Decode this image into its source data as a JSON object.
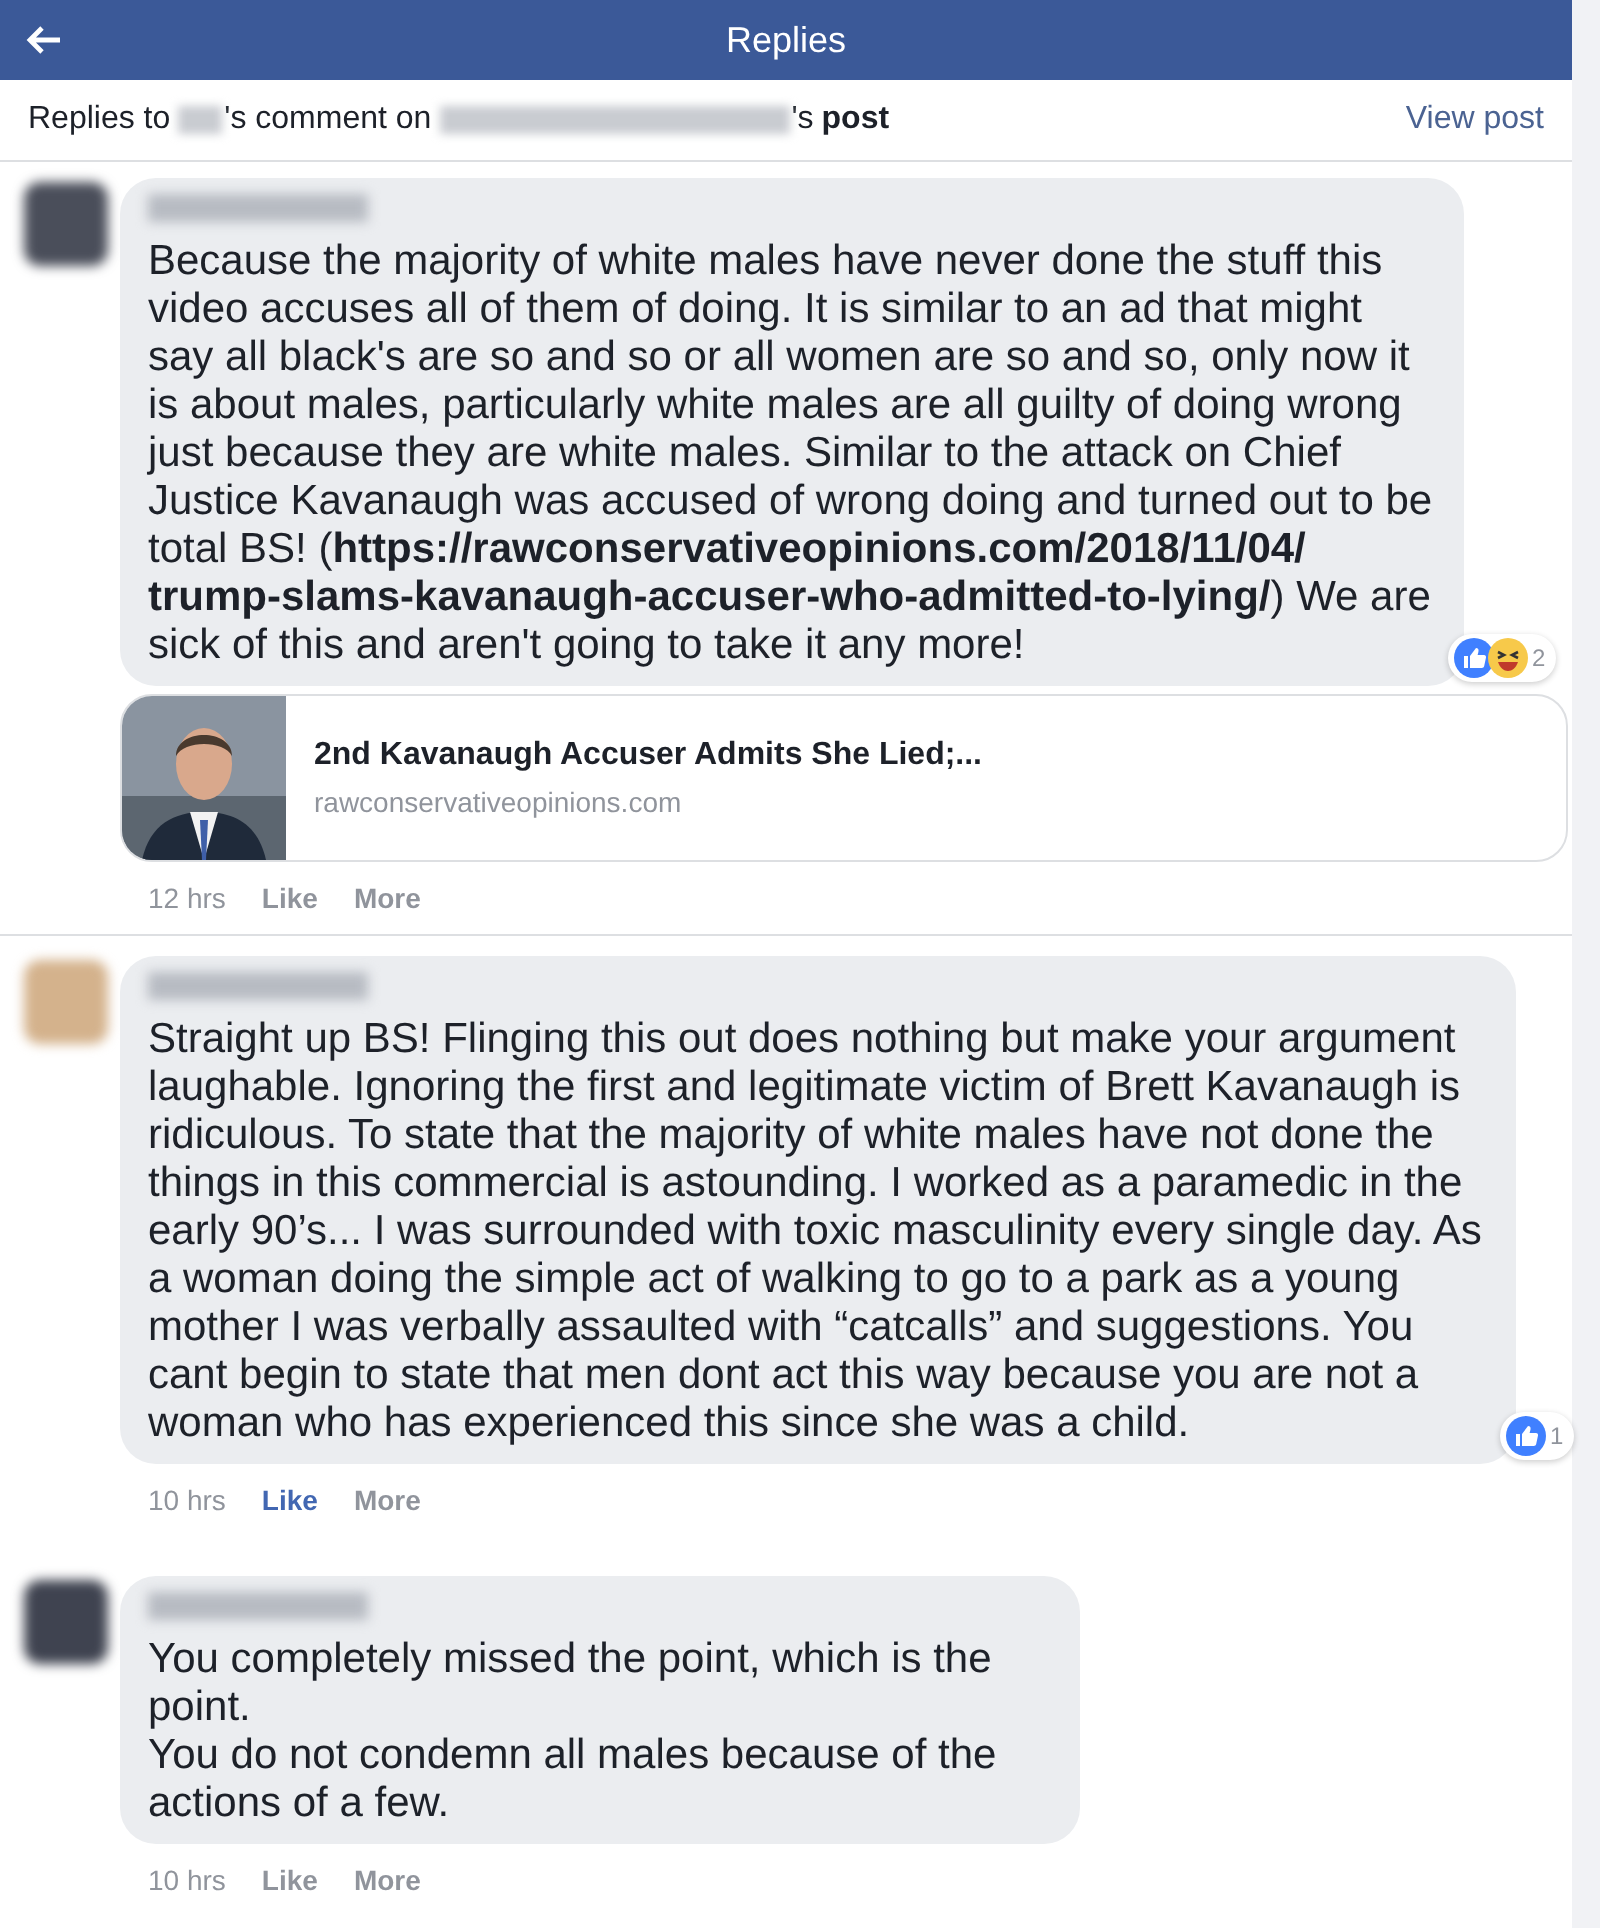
{
  "header": {
    "title": "Replies"
  },
  "context": {
    "prefix": "Replies to",
    "middle": "'s comment on",
    "suffix": "'s",
    "bold": "post",
    "link": "View post"
  },
  "comments": [
    {
      "text": "Because the majority of white males have never done the stuff this video accuses all of them of doing. It is similar to an ad that might say all black's are so and so or all women are so and so, only now it is about males, particularly white males are all guilty of doing wrong just because they are white males. Similar to the attack on Chief Justice Kavanaugh was accused of wrong doing and turned out to be total BS! (**https://rawconservativeopinions.com/2018/11/04/ trump-slams-kavanaugh-accuser-who-admitted-to-lying/**) We are sick of this and aren't going to take it any more!",
      "reactions": {
        "like": true,
        "haha": true,
        "count": "2"
      },
      "preview": {
        "title": "2nd Kavanaugh Accuser Admits She Lied;...",
        "domain": "rawconservativeopinions.com"
      },
      "time": "12 hrs",
      "like": {
        "label": "Like",
        "liked": false
      },
      "more": "More"
    },
    {
      "text": "Straight up BS! Flinging this out does nothing but make your argument laughable. Ignoring the first and legitimate victim of Brett Kavanaugh is ridiculous. To state that the majority of white males have not done the things in this commercial is astounding. I worked as a paramedic in the early 90’s... I was surrounded with toxic masculinity every single day. As a woman doing the simple act of walking to go to a park as a young mother I was verbally assaulted with “catcalls” and suggestions. You cant begin to state that men dont act this way because you are not a woman who has experienced this since she was a child.",
      "reactions": {
        "like": true,
        "haha": false,
        "count": "1"
      },
      "time": "10 hrs",
      "like": {
        "label": "Like",
        "liked": true
      },
      "more": "More"
    },
    {
      "text": "You completely missed the point, which is the point.\nYou do not condemn all males because of the actions of a few.",
      "time": "10 hrs",
      "like": {
        "label": "Like",
        "liked": false
      },
      "more": "More"
    }
  ]
}
